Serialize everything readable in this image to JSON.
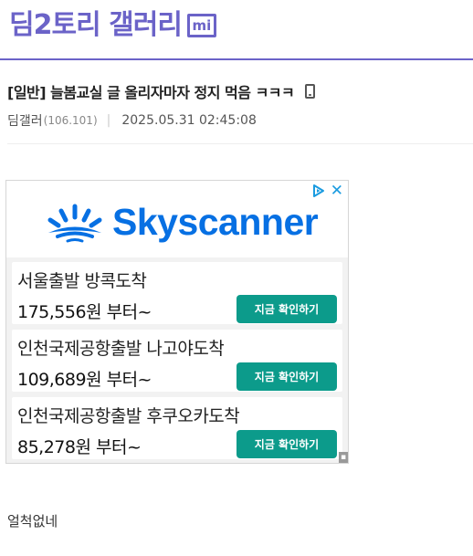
{
  "gallery": {
    "title": "딤2토리 갤러리",
    "badge": "mi",
    "accent_color": "#6b63c8"
  },
  "post": {
    "title": "[일반] 늘봄교실 글 올리자마자 정지 먹음 ㅋㅋㅋ",
    "device_icon": "phone-icon",
    "author": "딤갤러",
    "ip": "(106.101)",
    "date": "2025.05.31  02:45:08",
    "body": "얼척없네"
  },
  "ad": {
    "brand": "Skyscanner",
    "brand_color": "#0770e3",
    "cta_color": "#0c9b8b",
    "close_label": "✕",
    "info_label": "▪",
    "offers": [
      {
        "route": "서울출발 방콕도착",
        "price": "175,556원 부터~",
        "cta": "지금 확인하기"
      },
      {
        "route": "인천국제공항출발 나고야도착",
        "price": "109,689원 부터~",
        "cta": "지금 확인하기"
      },
      {
        "route": "인천국제공항출발 후쿠오카도착",
        "price": "85,278원 부터~",
        "cta": "지금 확인하기"
      }
    ]
  }
}
